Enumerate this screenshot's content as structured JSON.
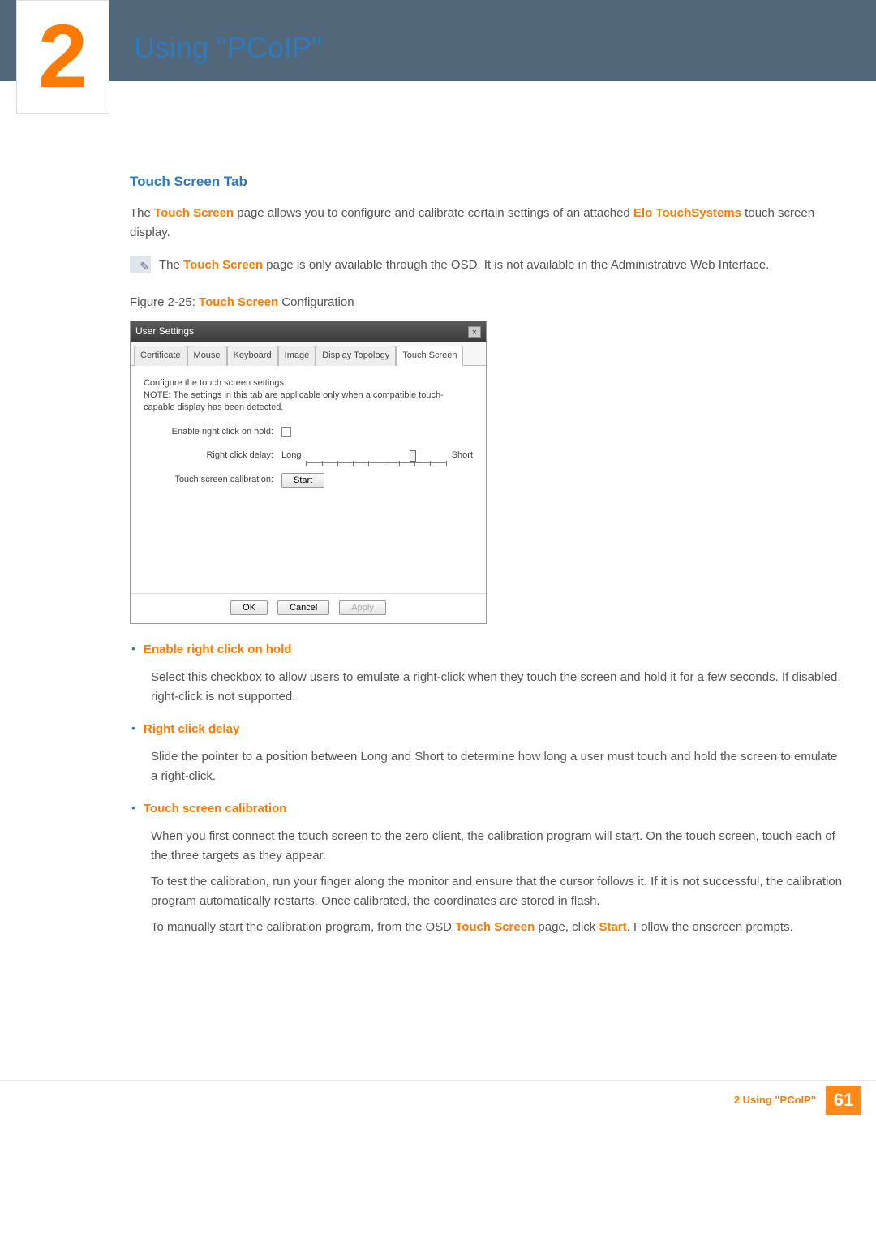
{
  "chapter": {
    "number": "2",
    "title": "Using \"PCoIP\""
  },
  "section": {
    "heading": "Touch Screen Tab"
  },
  "intro": {
    "part1": "The ",
    "em1": "Touch Screen",
    "part2": " page allows you to configure and calibrate certain settings of an attached ",
    "em2": "Elo TouchSystems",
    "part3": " touch screen display."
  },
  "note": {
    "part1": "The ",
    "em1": "Touch Screen",
    "part2": " page is only available through the OSD. It is not available in the Administrative Web Interface."
  },
  "figure": {
    "prefix": "Figure 2-25: ",
    "em": "Touch Screen",
    "suffix": " Configuration"
  },
  "dialog": {
    "title": "User Settings",
    "close": "×",
    "tabs": [
      "Certificate",
      "Mouse",
      "Keyboard",
      "Image",
      "Display Topology",
      "Touch Screen"
    ],
    "desc": "Configure the touch screen settings.\nNOTE: The settings in this tab are applicable only when a compatible touch-capable display has been detected.",
    "row1_label": "Enable right click on hold:",
    "row2_label": "Right click delay:",
    "slider_left": "Long",
    "slider_right": "Short",
    "row3_label": "Touch screen calibration:",
    "start_button": "Start",
    "ok": "OK",
    "cancel": "Cancel",
    "apply": "Apply"
  },
  "bullets": [
    {
      "title": "Enable right click on hold",
      "body": "Select this checkbox to allow users to emulate a right-click when they touch the screen and hold it for a few seconds. If disabled, right-click is not supported."
    },
    {
      "title": "Right click delay",
      "body": "Slide the pointer to a position between Long and Short to determine how long a user must touch and hold the screen to emulate a right-click."
    },
    {
      "title": "Touch screen calibration",
      "body_lines": [
        "When you first connect the touch screen to the zero client, the calibration program will start. On the touch screen, touch each of the three targets as they appear.",
        "To test the calibration, run your finger along the monitor and ensure that the cursor follows it. If it is not successful, the calibration program automatically restarts. Once calibrated, the coordinates are stored in flash."
      ],
      "tail_prefix": "To manually start the calibration program, from the OSD ",
      "tail_em1": "Touch Screen",
      "tail_mid": " page, click ",
      "tail_em2": "Start",
      "tail_suffix": ". Follow the onscreen prompts."
    }
  ],
  "footer": {
    "text": "2 Using \"PCoIP\"",
    "page": "61"
  }
}
